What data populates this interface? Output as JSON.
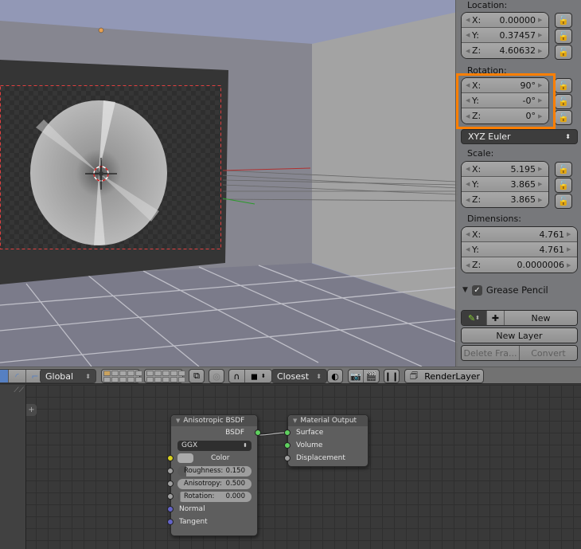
{
  "properties": {
    "location": {
      "label": "Location:",
      "x": {
        "axis": "X:",
        "value": "0.00000"
      },
      "y": {
        "axis": "Y:",
        "value": "0.37457"
      },
      "z": {
        "axis": "Z:",
        "value": "4.60632"
      }
    },
    "rotation": {
      "label": "Rotation:",
      "x": {
        "axis": "X:",
        "value": "90°"
      },
      "y": {
        "axis": "Y:",
        "value": "-0°"
      },
      "z": {
        "axis": "Z:",
        "value": "0°"
      },
      "mode": "XYZ Euler"
    },
    "scale": {
      "label": "Scale:",
      "x": {
        "axis": "X:",
        "value": "5.195"
      },
      "y": {
        "axis": "Y:",
        "value": "3.865"
      },
      "z": {
        "axis": "Z:",
        "value": "3.865"
      }
    },
    "dimensions": {
      "label": "Dimensions:",
      "x": {
        "axis": "X:",
        "value": "4.761"
      },
      "y": {
        "axis": "Y:",
        "value": "4.761"
      },
      "z": {
        "axis": "Z:",
        "value": "0.0000006"
      }
    },
    "grease_pencil": {
      "title": "Grease Pencil",
      "new_label": "New",
      "new_layer_label": "New Layer",
      "delete_frame_label": "Delete Fra...",
      "convert_label": "Convert"
    },
    "highlight_color": "#ff7f00"
  },
  "toolbar": {
    "orientation": "Global",
    "snap_target": "Closest",
    "render_layer": "RenderLayer"
  },
  "nodes": {
    "anisotropic": {
      "title": "Anisotropic BSDF",
      "output": "BSDF",
      "distribution": "GGX",
      "color_label": "Color",
      "roughness_label": "Roughness:",
      "roughness_value": "0.150",
      "anisotropy_label": "Anisotropy:",
      "anisotropy_value": "0.500",
      "rotation_label": "Rotation:",
      "rotation_value": "0.000",
      "normal_label": "Normal",
      "tangent_label": "Tangent"
    },
    "material_output": {
      "title": "Material Output",
      "surface": "Surface",
      "volume": "Volume",
      "displacement": "Displacement"
    }
  }
}
